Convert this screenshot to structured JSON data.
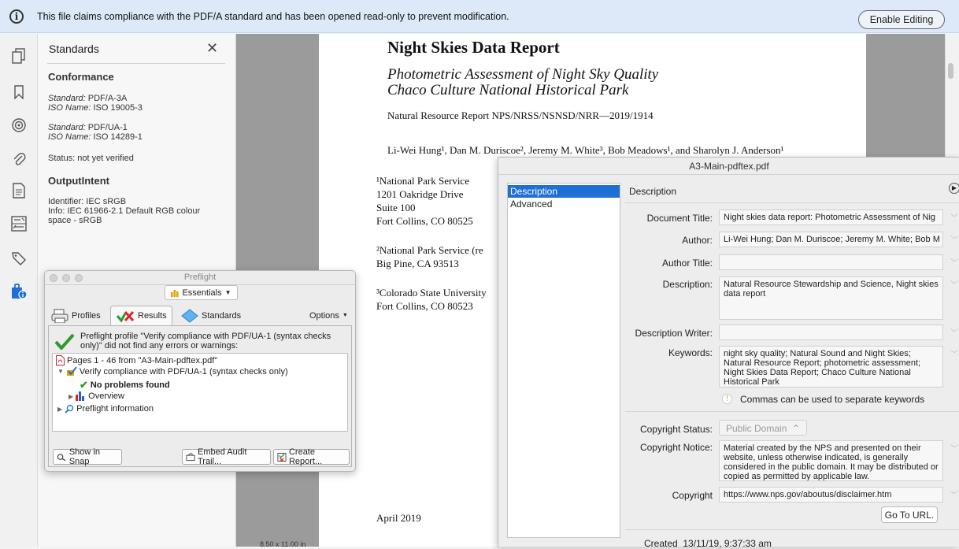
{
  "infobar": {
    "message": "This file claims compliance with the PDF/A standard and has been opened read-only to prevent modification.",
    "enable_editing_label": "Enable Editing"
  },
  "left_rail": {
    "icons": [
      "pages-icon",
      "bookmark-icon",
      "layers-icon",
      "attachment-icon",
      "form-icon",
      "compare-icon",
      "tag-icon",
      "standards-info-icon"
    ]
  },
  "standards_panel": {
    "title": "Standards",
    "conformance_heading": "Conformance",
    "std1_label": "Standard:",
    "std1_value": "PDF/A-3A",
    "std1_iso_label": "ISO Name:",
    "std1_iso_value": "ISO 19005-3",
    "std2_label": "Standard:",
    "std2_value": "PDF/UA-1",
    "std2_iso_label": "ISO Name:",
    "std2_iso_value": "ISO 14289-1",
    "status": "Status: not yet verified",
    "output_heading": "OutputIntent",
    "identifier": "Identifier: IEC sRGB",
    "info_line1": "Info: IEC 61966-2.1 Default RGB colour",
    "info_line2": "space - sRGB"
  },
  "pdf_page": {
    "title": "Night Skies Data Report",
    "subtitle1": "Photometric Assessment of Night Sky Quality",
    "subtitle2": "Chaco Culture National Historical Park",
    "report_number": "Natural Resource Report NPS/NRSS/NSNSD/NRR—2019/1914",
    "authors": "Li-Wei Hung¹, Dan M. Duriscoe², Jeremy M. White³, Bob Meadows¹, and Sharolyn J. Anderson¹",
    "aff1": [
      "¹National Park Service",
      "1201 Oakridge Drive",
      "Suite 100",
      "Fort Collins, CO 80525"
    ],
    "aff2": [
      "²National Park Service (re",
      "Big Pine, CA 93513"
    ],
    "aff3": [
      "³Colorado State University",
      "Fort Collins, CO 80523"
    ],
    "date": "April 2019",
    "page_size": "8.50 x 11.00 in"
  },
  "preflight": {
    "title": "Preflight",
    "essentials_label": "Essentials",
    "tab_profiles": "Profiles",
    "tab_results": "Results",
    "tab_standards": "Standards",
    "options_label": "Options",
    "result_message": "Preflight profile \"Verify compliance with PDF/UA-1 (syntax checks only)\" did not find any errors or warnings:",
    "tree": {
      "pages": "Pages 1 - 46 from \"A3-Main-pdftex.pdf\"",
      "profile": "Verify compliance with PDF/UA-1 (syntax checks only)",
      "no_problems": "No problems found",
      "overview": "Overview",
      "info": "Preflight information"
    },
    "show_in_snap": "Show in Snap",
    "embed_audit": "Embed Audit Trail...",
    "create_report": "Create Report..."
  },
  "doc_props": {
    "window_title": "A3-Main-pdftex.pdf",
    "list_items": [
      "Description",
      "Advanced"
    ],
    "section_title": "Description",
    "labels": {
      "document_title": "Document Title:",
      "author": "Author:",
      "author_title": "Author Title:",
      "description": "Description:",
      "description_writer": "Description Writer:",
      "keywords": "Keywords:",
      "copyright_status": "Copyright Status:",
      "copyright_notice": "Copyright Notice:",
      "copyright": "Copyright"
    },
    "values": {
      "document_title": "Night skies data report: Photometric Assessment of Nig",
      "author": "Li-Wei Hung; Dan M. Duriscoe; Jeremy M. White; Bob M",
      "author_title": "",
      "description": "Natural Resource Stewardship and Science, Night skies data report",
      "description_writer": "",
      "keywords": "night sky quality; Natural Sound and Night Skies; Natural Resource Report; photometric assessment; Night Skies Data Report; Chaco Culture National Historical Park",
      "copyright_status": "Public Domain",
      "copyright_notice": "Material created by the NPS and presented on their website, unless otherwise indicated, is generally considered in the public domain. It may be distributed or copied as permitted by applicable law.",
      "copyright": "https://www.nps.gov/aboutus/disclaimer.htm"
    },
    "keywords_hint": "Commas can be used to separate keywords",
    "go_to_url": "Go To URL.",
    "created_label": "Created",
    "created_value": "13/11/19, 9:37:33 am"
  }
}
